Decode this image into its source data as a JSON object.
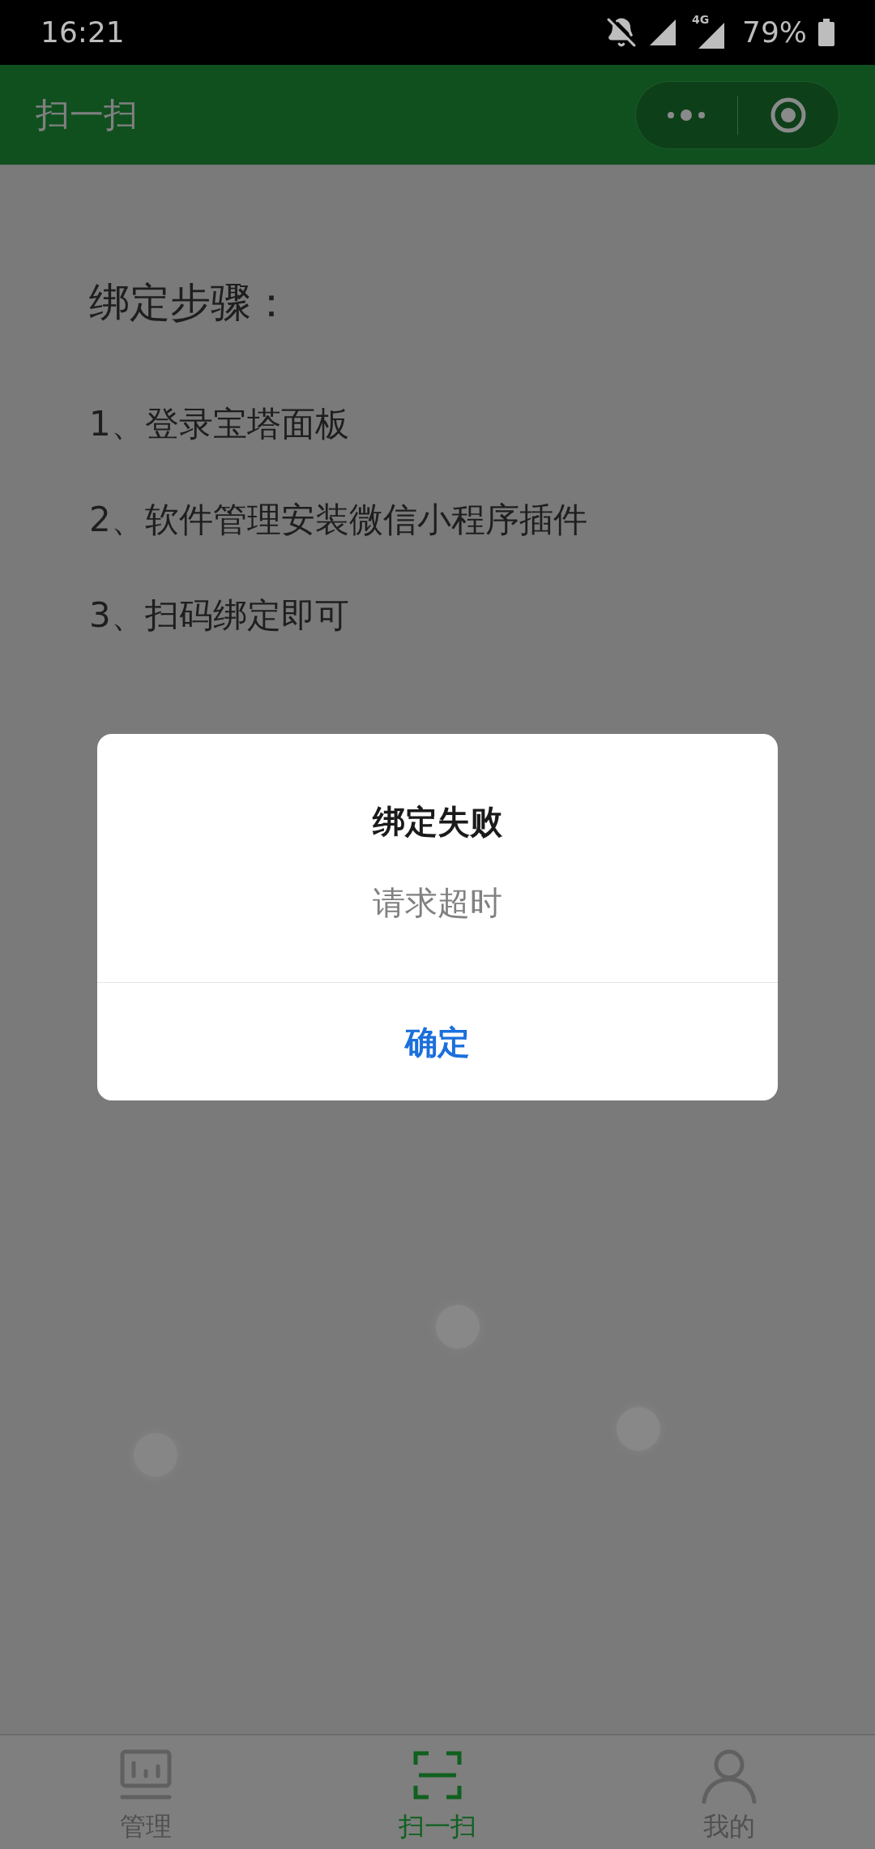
{
  "status_bar": {
    "time": "16:21",
    "network": "4G",
    "battery": "79%"
  },
  "header": {
    "title": "扫一扫"
  },
  "content": {
    "title": "绑定步骤：",
    "steps": [
      "1、登录宝塔面板",
      "2、软件管理安装微信小程序插件",
      "3、扫码绑定即可"
    ]
  },
  "dialog": {
    "title": "绑定失败",
    "message": "请求超时",
    "button": "确定"
  },
  "tab_bar": [
    {
      "label": "管理",
      "kind": "panel",
      "selected": false
    },
    {
      "label": "扫一扫",
      "kind": "scan",
      "selected": true
    },
    {
      "label": "我的",
      "kind": "user",
      "selected": false
    }
  ]
}
